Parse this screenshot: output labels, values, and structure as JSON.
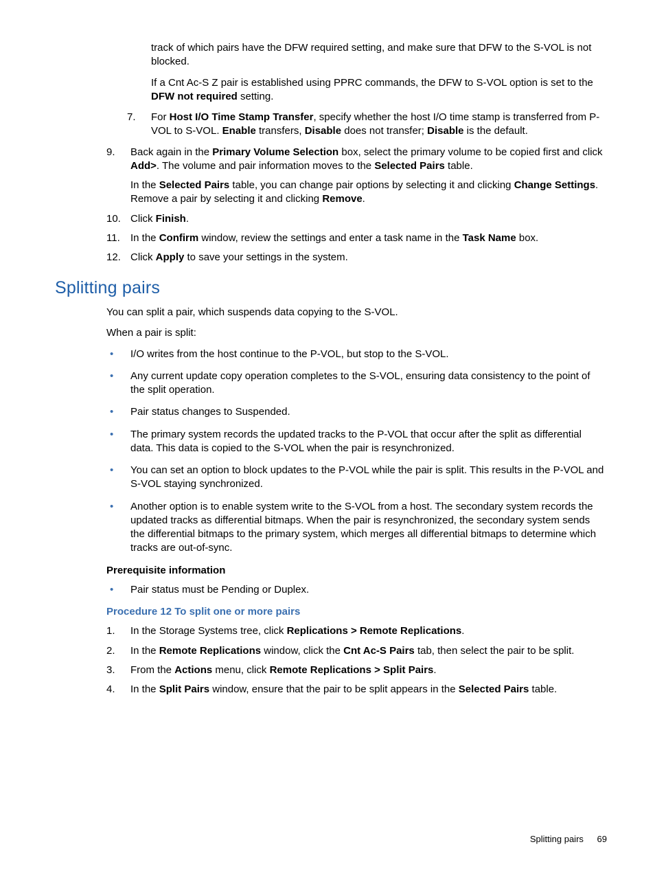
{
  "top": {
    "p1": "track of which pairs have the DFW required setting, and make sure that DFW to the S-VOL is not blocked.",
    "p2_a": "If a Cnt Ac-S Z pair is established using PPRC commands, the DFW to S-VOL option is set to the ",
    "p2_b": "DFW not required",
    "p2_c": " setting."
  },
  "sub7": {
    "num": "7",
    "a": "For ",
    "b": "Host I/O Time Stamp Transfer",
    "c": ", specify whether the host I/O time stamp is transferred from P-VOL to S-VOL. ",
    "d": "Enable",
    "e": " transfers, ",
    "f": "Disable",
    "g": " does not transfer; ",
    "h": "Disable",
    "i": " is the default."
  },
  "step9": {
    "num": "9",
    "a": "Back again in the ",
    "b": "Primary Volume Selection",
    "c": " box, select the primary volume to be copied first and click ",
    "d": "Add>",
    "e": ". The volume and pair information moves to the ",
    "f": "Selected Pairs",
    "g": " table.",
    "p2_a": "In the ",
    "p2_b": "Selected Pairs",
    "p2_c": " table, you can change pair options by selecting it and clicking ",
    "p2_d": "Change Settings",
    "p2_e": ". Remove a pair by selecting it and clicking ",
    "p2_f": "Remove",
    "p2_g": "."
  },
  "step10": {
    "num": "10",
    "a": "Click ",
    "b": "Finish",
    "c": "."
  },
  "step11": {
    "num": "11",
    "a": "In the ",
    "b": "Confirm",
    "c": " window, review the settings and enter a task name in the ",
    "d": "Task Name",
    "e": " box."
  },
  "step12": {
    "num": "12",
    "a": "Click ",
    "b": "Apply",
    "c": " to save your settings in the system."
  },
  "heading": "Splitting pairs",
  "split": {
    "p1": "You can split a pair, which suspends data copying to the S-VOL.",
    "p2": "When a pair is split:"
  },
  "bullets": [
    "I/O writes from the host continue to the P-VOL, but stop to the S-VOL.",
    "Any current update copy operation completes to the S-VOL, ensuring data consistency to the point of the split operation.",
    "Pair status changes to Suspended.",
    "The primary system records the updated tracks to the P-VOL that occur after the split as differential data. This data is copied to the S-VOL when the pair is resynchronized.",
    "You can set an option to block updates to the P-VOL while the pair is split. This results in the P-VOL and S-VOL staying synchronized.",
    "Another option is to enable system write to the S-VOL from a host. The secondary system records the updated tracks as differential bitmaps. When the pair is resynchronized, the secondary system sends the differential bitmaps to the primary system, which merges all differential bitmaps to determine which tracks are out-of-sync."
  ],
  "prereq": {
    "head": "Prerequisite information",
    "bullet": "Pair status must be Pending or Duplex."
  },
  "proc": {
    "head": "Procedure 12 To split one or more pairs",
    "s1": {
      "num": "1",
      "a": "In the Storage Systems tree, click ",
      "b": "Replications > Remote Replications",
      "c": "."
    },
    "s2": {
      "num": "2",
      "a": "In the ",
      "b": "Remote Replications",
      "c": " window, click the ",
      "d": "Cnt Ac-S Pairs",
      "e": " tab, then select the pair to be split."
    },
    "s3": {
      "num": "3",
      "a": "From the ",
      "b": "Actions",
      "c": " menu, click ",
      "d": "Remote Replications > Split Pairs",
      "e": "."
    },
    "s4": {
      "num": "4",
      "a": "In the ",
      "b": "Split Pairs",
      "c": " window, ensure that the pair to be split appears in the ",
      "d": "Selected Pairs",
      "e": " table."
    }
  },
  "footer": {
    "title": "Splitting pairs",
    "page": "69"
  }
}
